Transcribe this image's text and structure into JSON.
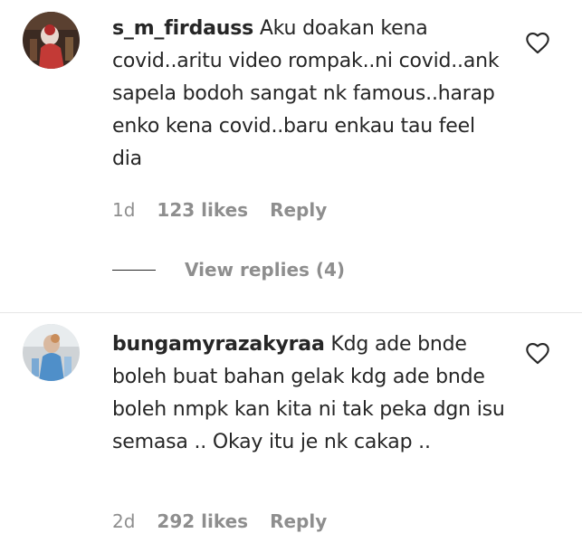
{
  "comments": [
    {
      "username": "s_m_firdauss",
      "text": "Aku doakan kena covid..aritu video rompak..ni covid..ank sapela bodoh sangat nk famous..harap enko kena covid..baru enkau tau feel dia",
      "age": "1d",
      "likes": "123 likes",
      "reply_label": "Reply",
      "view_replies": "View replies (4)",
      "avatar_icon": "user-avatar-photo"
    },
    {
      "username": "bungamyrazakyraa",
      "text": "Kdg ade bnde boleh buat bahan gelak kdg ade bnde boleh nmpk kan kita ni tak peka dgn isu semasa .. Okay itu je nk cakap ..",
      "age": "2d",
      "likes": "292 likes",
      "reply_label": "Reply",
      "avatar_icon": "user-avatar-photo"
    }
  ],
  "icons": {
    "like": "heart-outline-icon"
  },
  "colors": {
    "text": "#262626",
    "secondary": "#8e8e8e",
    "background": "#ffffff"
  }
}
